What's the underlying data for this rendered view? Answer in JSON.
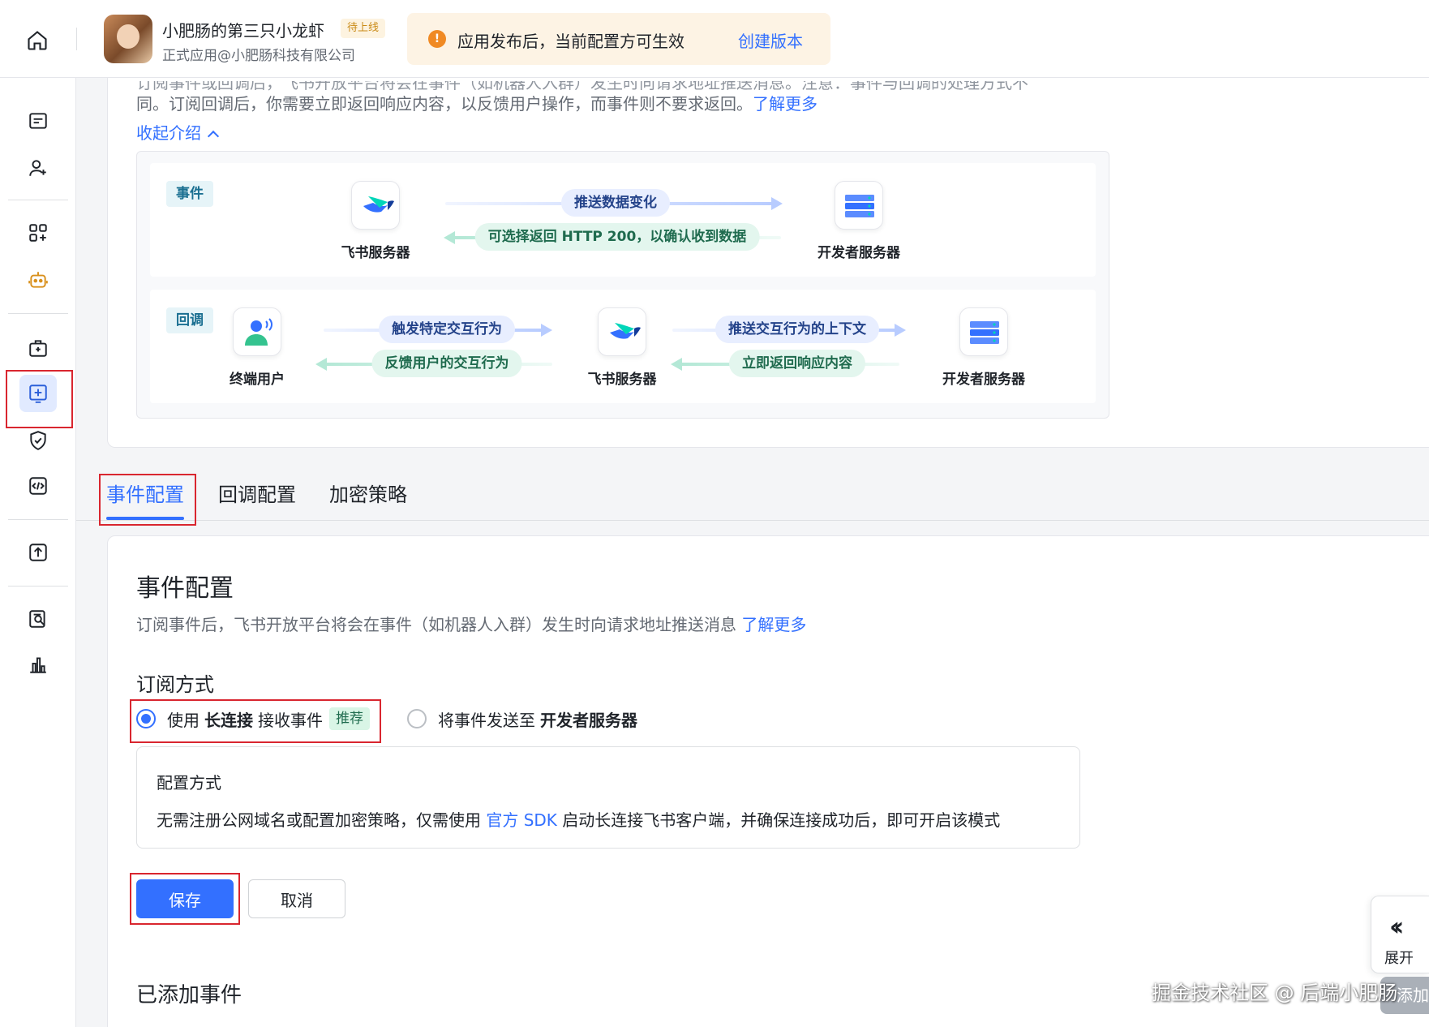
{
  "header": {
    "app_name": "小肥肠的第三只小龙虾",
    "app_status_badge": "待上线",
    "app_subtitle": "正式应用@小肥肠科技有限公司",
    "notice_text": "应用发布后，当前配置方可生效",
    "notice_link": "创建版本"
  },
  "sidebar": {
    "items": [
      {
        "icon": "home-icon"
      },
      {
        "icon": "basic-info-icon"
      },
      {
        "icon": "member-icon"
      },
      {
        "icon": "app-capability-icon"
      },
      {
        "icon": "bot-icon"
      },
      {
        "icon": "permission-icon"
      },
      {
        "icon": "events-callbacks-icon",
        "active": true
      },
      {
        "icon": "security-icon"
      },
      {
        "icon": "code-icon"
      },
      {
        "icon": "version-release-icon"
      },
      {
        "icon": "log-search-icon"
      },
      {
        "icon": "analytics-icon"
      }
    ]
  },
  "intro": {
    "line1": "订阅事件或回调后，飞书开放平台将会在事件（如机器人入群）发生时向请求地址推送消息。注意：事件与回调的处理方式不",
    "line2": "同。订阅回调后，你需要立即返回响应内容，以反馈用户操作，而事件则不要求返回。",
    "learn_more": "了解更多",
    "collapse": "收起介绍",
    "diagram": {
      "event_tag": "事件",
      "callback_tag": "回调",
      "feishu_server": "飞书服务器",
      "developer_server": "开发者服务器",
      "end_user": "终端用户",
      "event_push": "推送数据变化",
      "event_return": "可选择返回 HTTP 200，以确认收到数据",
      "cb_trigger": "触发特定交互行为",
      "cb_feedback": "反馈用户的交互行为",
      "cb_push_context": "推送交互行为的上下文",
      "cb_return": "立即返回响应内容"
    }
  },
  "tabs": [
    {
      "label": "事件配置",
      "active": true
    },
    {
      "label": "回调配置",
      "active": false
    },
    {
      "label": "加密策略",
      "active": false
    }
  ],
  "config": {
    "title": "事件配置",
    "desc": "订阅事件后，飞书开放平台将会在事件（如机器人入群）发生时向请求地址推送消息",
    "desc_link": "了解更多",
    "subscribe_title": "订阅方式",
    "opt1_prefix": "使用",
    "opt1_bold": "长连接",
    "opt1_suffix": "接收事件",
    "opt1_badge": "推荐",
    "opt2_prefix": "将事件发送至",
    "opt2_bold": "开发者服务器",
    "box_title": "配置方式",
    "box_text_pre": "无需注册公网域名或配置加密策略，仅需使用",
    "box_link": "官方 SDK",
    "box_text_post": "启动长连接飞书客户端，并确保连接成功后，即可开启该模式",
    "save": "保存",
    "cancel": "取消",
    "added_events": "已添加事件"
  },
  "floating": {
    "expand_label": "展开",
    "add_label": "添加",
    "watermark": "掘金技术社区 @ 后端小肥肠"
  }
}
